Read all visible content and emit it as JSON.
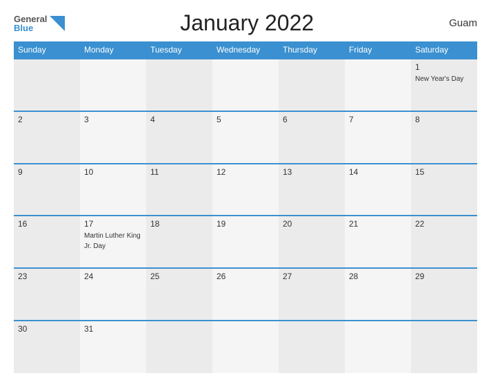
{
  "header": {
    "logo_general": "General",
    "logo_blue": "Blue",
    "title": "January 2022",
    "region": "Guam"
  },
  "weekdays": [
    "Sunday",
    "Monday",
    "Tuesday",
    "Wednesday",
    "Thursday",
    "Friday",
    "Saturday"
  ],
  "weeks": [
    [
      {
        "day": "",
        "holiday": ""
      },
      {
        "day": "",
        "holiday": ""
      },
      {
        "day": "",
        "holiday": ""
      },
      {
        "day": "",
        "holiday": ""
      },
      {
        "day": "",
        "holiday": ""
      },
      {
        "day": "",
        "holiday": ""
      },
      {
        "day": "1",
        "holiday": "New Year's Day"
      }
    ],
    [
      {
        "day": "2",
        "holiday": ""
      },
      {
        "day": "3",
        "holiday": ""
      },
      {
        "day": "4",
        "holiday": ""
      },
      {
        "day": "5",
        "holiday": ""
      },
      {
        "day": "6",
        "holiday": ""
      },
      {
        "day": "7",
        "holiday": ""
      },
      {
        "day": "8",
        "holiday": ""
      }
    ],
    [
      {
        "day": "9",
        "holiday": ""
      },
      {
        "day": "10",
        "holiday": ""
      },
      {
        "day": "11",
        "holiday": ""
      },
      {
        "day": "12",
        "holiday": ""
      },
      {
        "day": "13",
        "holiday": ""
      },
      {
        "day": "14",
        "holiday": ""
      },
      {
        "day": "15",
        "holiday": ""
      }
    ],
    [
      {
        "day": "16",
        "holiday": ""
      },
      {
        "day": "17",
        "holiday": "Martin Luther King Jr. Day"
      },
      {
        "day": "18",
        "holiday": ""
      },
      {
        "day": "19",
        "holiday": ""
      },
      {
        "day": "20",
        "holiday": ""
      },
      {
        "day": "21",
        "holiday": ""
      },
      {
        "day": "22",
        "holiday": ""
      }
    ],
    [
      {
        "day": "23",
        "holiday": ""
      },
      {
        "day": "24",
        "holiday": ""
      },
      {
        "day": "25",
        "holiday": ""
      },
      {
        "day": "26",
        "holiday": ""
      },
      {
        "day": "27",
        "holiday": ""
      },
      {
        "day": "28",
        "holiday": ""
      },
      {
        "day": "29",
        "holiday": ""
      }
    ],
    [
      {
        "day": "30",
        "holiday": ""
      },
      {
        "day": "31",
        "holiday": ""
      },
      {
        "day": "",
        "holiday": ""
      },
      {
        "day": "",
        "holiday": ""
      },
      {
        "day": "",
        "holiday": ""
      },
      {
        "day": "",
        "holiday": ""
      },
      {
        "day": "",
        "holiday": ""
      }
    ]
  ],
  "colors": {
    "header_bg": "#3a90d0",
    "row_odd": "#ebebeb",
    "row_even": "#f5f5f5",
    "border": "#3a90d0"
  }
}
